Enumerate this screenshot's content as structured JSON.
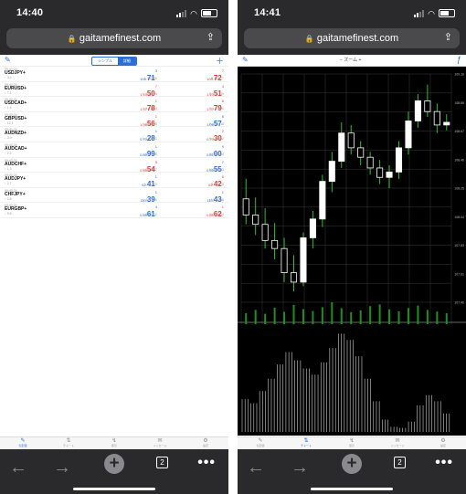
{
  "left": {
    "status": {
      "time": "14:40"
    },
    "browser": {
      "url": "gaitamefinest.com"
    },
    "segments": [
      "シンプル",
      "詳細"
    ],
    "quotes": [
      {
        "time": "09:40:24",
        "symbol": "USDJPY+",
        "sub": "↑ 3.4",
        "bid_small": "108.",
        "bid_big": "71",
        "bid_sup": "3",
        "ask_small": "108.",
        "ask_big": "72",
        "ask_sup": "7",
        "bid_color": "blue",
        "ask_color": "red",
        "low": "L:108.35",
        "high": "H:108.77"
      },
      {
        "time": "09:40:24",
        "symbol": "EURUSD+",
        "sub": "↓ 7.1",
        "bid_small": "1.10",
        "bid_big": "50",
        "bid_sup": "7",
        "ask_small": "1.10",
        "ask_big": "51",
        "ask_sup": "4",
        "bid_color": "red",
        "ask_color": "red",
        "low": "L:1.10225",
        "high": "H:1.10719"
      },
      {
        "time": "09:40:24",
        "symbol": "USDCAD+",
        "sub": "↑ 1.4",
        "bid_small": "1.37",
        "bid_big": "78",
        "bid_sup": "1",
        "ask_small": "1.37",
        "ask_big": "79",
        "ask_sup": "8",
        "bid_color": "red",
        "ask_color": "red",
        "low": "L:1.37304",
        "high": "H:1.37980"
      },
      {
        "time": "09:40:24",
        "symbol": "GBPUSD+",
        "sub": "↓ 12.1",
        "bid_small": "1.06",
        "bid_big": "56",
        "bid_sup": "1",
        "ask_small": "1.06",
        "ask_big": "57",
        "ask_sup": "6",
        "bid_color": "red",
        "ask_color": "blue",
        "low": "L:1.06325",
        "high": "H:1.07016"
      },
      {
        "time": "09:40:24",
        "symbol": "AUDNZD+",
        "sub": "↓ 3.9",
        "bid_small": "0.70",
        "bid_big": "28",
        "bid_sup": "1",
        "ask_small": "0.70",
        "ask_big": "30",
        "ask_sup": "2",
        "bid_color": "blue",
        "ask_color": "red",
        "low": "L:1.04071",
        "high": "H:1.04532"
      },
      {
        "time": "09:40:24",
        "symbol": "AUDCAD+",
        "sub": "↑ 2.2",
        "bid_small": "0.80",
        "bid_big": "99",
        "bid_sup": "1",
        "ask_small": "0.81",
        "ask_big": "00",
        "ask_sup": "9",
        "bid_color": "blue",
        "ask_color": "blue",
        "low": "L:0.79368",
        "high": "H:0.80624"
      },
      {
        "time": "09:40:24",
        "symbol": "AUDCHF+",
        "sub": "↑ 1.3",
        "bid_small": "0.55",
        "bid_big": "54",
        "bid_sup": "9",
        "ask_small": "0.55",
        "ask_big": "55",
        "ask_sup": "7",
        "bid_color": "red",
        "ask_color": "blue",
        "low": "L:0.54897",
        "high": "H:0.55983"
      },
      {
        "time": "09:40:24",
        "symbol": "AUDJPY+",
        "sub": "↑ 2.7",
        "bid_small": "62.",
        "bid_big": "41",
        "bid_sup": "1",
        "ask_small": "62.",
        "ask_big": "42",
        "ask_sup": "8",
        "bid_color": "blue",
        "ask_color": "red",
        "low": "L:62.000",
        "high": "H:62.578"
      },
      {
        "time": "09:40:24",
        "symbol": "CHFJPY+",
        "sub": "↑ 2.8",
        "bid_small": "110.",
        "bid_big": "39",
        "bid_sup": "1",
        "ask_small": "110.",
        "ask_big": "43",
        "ask_sup": "1",
        "bid_color": "blue",
        "ask_color": "blue",
        "low": "L:109.886",
        "high": "H:110.556"
      },
      {
        "time": "09:40:24",
        "symbol": "EURGBP+",
        "sub": "↑ 5.6",
        "bid_small": "0.89",
        "bid_big": "61",
        "bid_sup": "4",
        "ask_small": "0.89",
        "ask_big": "62",
        "ask_sup": "1",
        "bid_color": "blue",
        "ask_color": "red",
        "low": "L:0.89512",
        "high": "H:0.90114"
      }
    ],
    "tabs": [
      {
        "icon": "✎",
        "label": "気配値"
      },
      {
        "icon": "⇅",
        "label": "チャート"
      },
      {
        "icon": "↯",
        "label": "取引"
      },
      {
        "icon": "✉",
        "label": "メッセージ"
      },
      {
        "icon": "⚙",
        "label": "設定"
      }
    ]
  },
  "right": {
    "status": {
      "time": "14:41"
    },
    "browser": {
      "url": "gaitamefinest.com"
    },
    "chart_header": {
      "zoom_label": "−  ズーム  +"
    },
    "tabs": [
      {
        "icon": "✎",
        "label": "気配値"
      },
      {
        "icon": "⇅",
        "label": "チャート"
      },
      {
        "icon": "↯",
        "label": "取引"
      },
      {
        "icon": "✉",
        "label": "メッセージ"
      },
      {
        "icon": "⚙",
        "label": "設定"
      }
    ]
  },
  "browser_toolbar": {
    "back": "←",
    "forward": "→",
    "new_tab": "+",
    "tab_count": "2",
    "more": "•••"
  },
  "colors": {
    "bull": "#ffffff",
    "bear": "#ffffff",
    "wick": "#2fbf2f",
    "volume": "#1f8f1f",
    "osc": "#d0d0d0",
    "grid": "#3a3a3a",
    "accent": "#2a6fd6",
    "bid_red": "#e03a2e"
  },
  "chart_data": {
    "type": "candlestick",
    "candles": [
      {
        "o": 108.17,
        "h": 108.32,
        "l": 107.98,
        "c": 108.05
      },
      {
        "o": 108.05,
        "h": 108.18,
        "l": 107.9,
        "c": 107.98
      },
      {
        "o": 107.98,
        "h": 108.1,
        "l": 107.8,
        "c": 107.86
      },
      {
        "o": 107.86,
        "h": 107.99,
        "l": 107.72,
        "c": 107.8
      },
      {
        "o": 107.8,
        "h": 107.88,
        "l": 107.55,
        "c": 107.62
      },
      {
        "o": 107.62,
        "h": 107.75,
        "l": 107.48,
        "c": 107.55
      },
      {
        "o": 107.55,
        "h": 107.92,
        "l": 107.52,
        "c": 107.88
      },
      {
        "o": 107.88,
        "h": 108.08,
        "l": 107.8,
        "c": 108.02
      },
      {
        "o": 108.02,
        "h": 108.35,
        "l": 107.96,
        "c": 108.3
      },
      {
        "o": 108.3,
        "h": 108.52,
        "l": 108.22,
        "c": 108.45
      },
      {
        "o": 108.45,
        "h": 108.74,
        "l": 108.4,
        "c": 108.66
      },
      {
        "o": 108.66,
        "h": 108.72,
        "l": 108.5,
        "c": 108.55
      },
      {
        "o": 108.55,
        "h": 108.6,
        "l": 108.42,
        "c": 108.48
      },
      {
        "o": 108.48,
        "h": 108.52,
        "l": 108.35,
        "c": 108.4
      },
      {
        "o": 108.4,
        "h": 108.46,
        "l": 108.28,
        "c": 108.33
      },
      {
        "o": 108.33,
        "h": 108.42,
        "l": 108.25,
        "c": 108.37
      },
      {
        "o": 108.37,
        "h": 108.6,
        "l": 108.32,
        "c": 108.55
      },
      {
        "o": 108.55,
        "h": 108.82,
        "l": 108.5,
        "c": 108.75
      },
      {
        "o": 108.75,
        "h": 108.95,
        "l": 108.7,
        "c": 108.9
      },
      {
        "o": 108.9,
        "h": 109.02,
        "l": 108.78,
        "c": 108.82
      },
      {
        "o": 108.82,
        "h": 108.88,
        "l": 108.66,
        "c": 108.72
      },
      {
        "o": 108.72,
        "h": 108.8,
        "l": 108.68,
        "c": 108.74
      }
    ],
    "volume": [
      40,
      52,
      38,
      60,
      45,
      70,
      55,
      48,
      62,
      80,
      58,
      44,
      50,
      66,
      72,
      54,
      47,
      59,
      68,
      52,
      46,
      40
    ],
    "oscillator": [
      0.32,
      0.28,
      0.4,
      0.52,
      0.66,
      0.78,
      0.7,
      0.62,
      0.56,
      0.68,
      0.82,
      0.96,
      0.9,
      0.74,
      0.52,
      0.3,
      0.12,
      0.05,
      0.04,
      0.1,
      0.26,
      0.36,
      0.3,
      0.18
    ],
    "ylim": [
      107.4,
      109.1
    ]
  }
}
